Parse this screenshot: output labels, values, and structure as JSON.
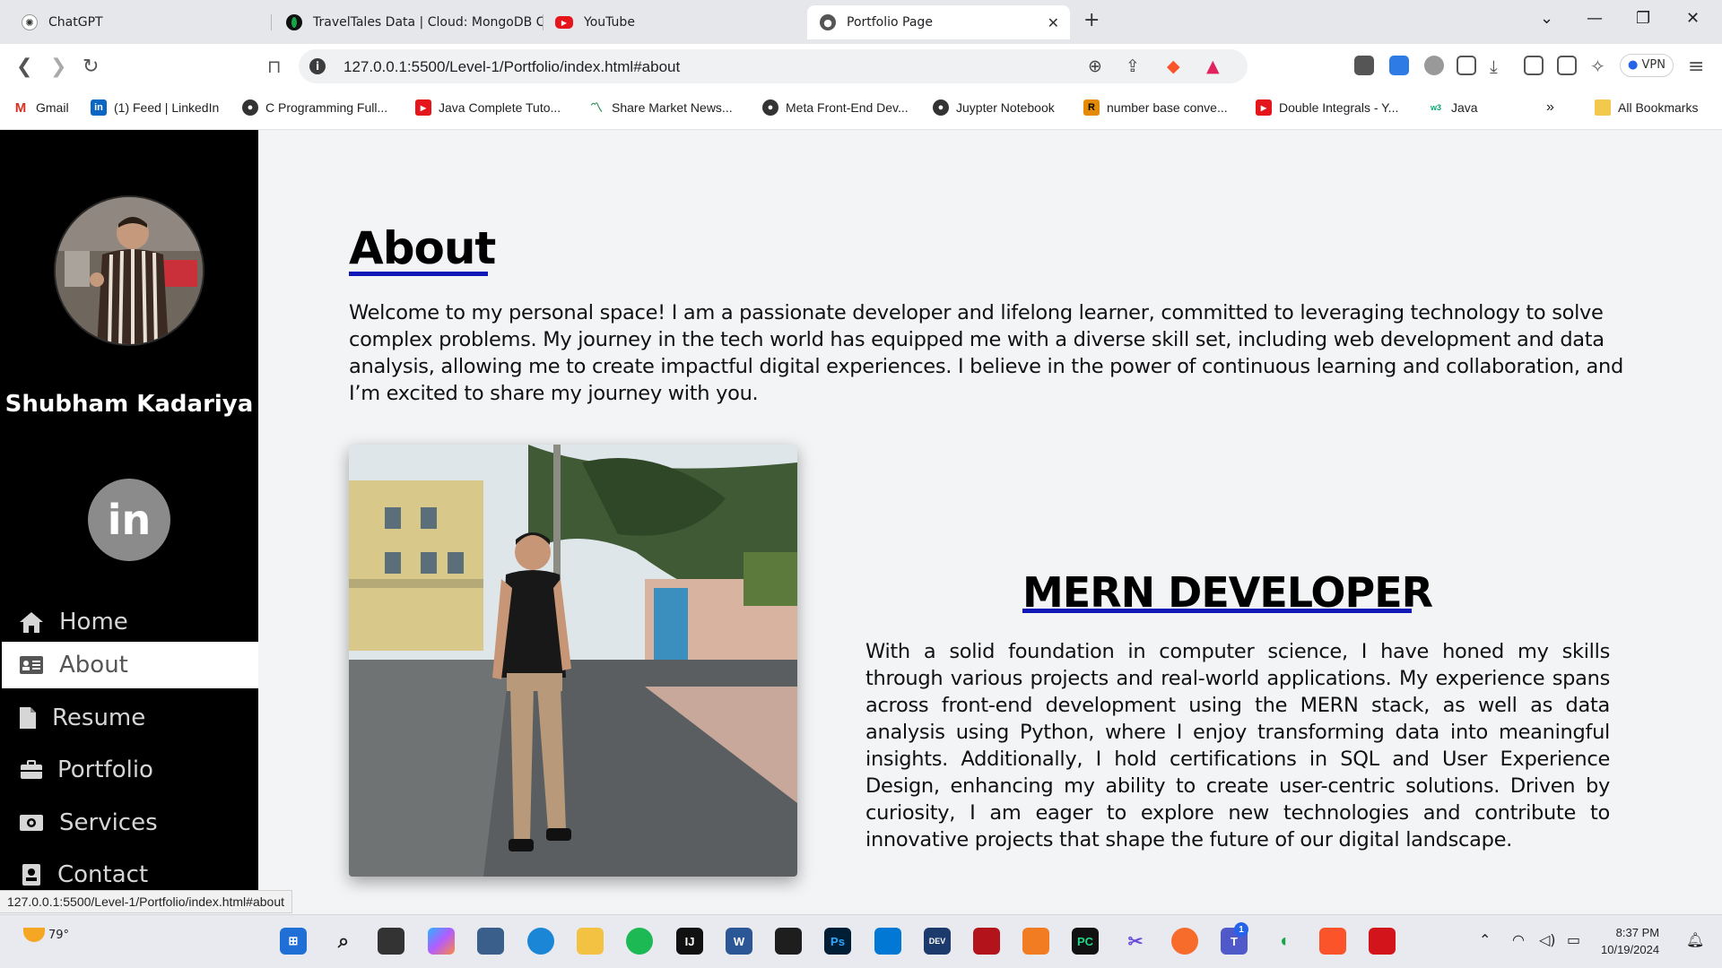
{
  "browser": {
    "tabs": [
      {
        "title": "ChatGPT",
        "active": false
      },
      {
        "title": "TravelTales Data | Cloud: MongoDB C",
        "active": false
      },
      {
        "title": "YouTube",
        "active": false
      },
      {
        "title": "Portfolio Page",
        "active": true
      }
    ],
    "url": "127.0.0.1:5500/Level-1/Portfolio/index.html#about",
    "vpn_label": "VPN",
    "bookmarks": [
      "Gmail",
      "(1) Feed | LinkedIn",
      "C Programming Full...",
      "Java Complete Tuto...",
      "Share Market News...",
      "Meta Front-End Dev...",
      "Juypter Notebook",
      "number base conve...",
      "Double Integrals - Y...",
      "Java"
    ],
    "all_bookmarks_label": "All Bookmarks",
    "status_url": "127.0.0.1:5500/Level-1/Portfolio/index.html#about"
  },
  "sidebar": {
    "name": "Shubham Kadariya",
    "linkedin_glyph": "in",
    "nav": [
      {
        "label": "Home",
        "icon": "home-icon",
        "active": false
      },
      {
        "label": "About",
        "icon": "id-card-icon",
        "active": true
      },
      {
        "label": "Resume",
        "icon": "file-icon",
        "active": false
      },
      {
        "label": "Portfolio",
        "icon": "briefcase-icon",
        "active": false
      },
      {
        "label": "Services",
        "icon": "money-icon",
        "active": false
      },
      {
        "label": "Contact",
        "icon": "address-book-icon",
        "active": false
      }
    ]
  },
  "about": {
    "title": "About",
    "intro": "Welcome to my personal space! I am a passionate developer and lifelong learner, committed to leveraging technology to solve complex problems. My journey in the tech world has equipped me with a diverse skill set, including web development and data analysis, allowing me to create impactful digital experiences. I believe in the power of continuous learning and collaboration, and I’m excited to share my journey with you.",
    "role_title": "MERN DEVELOPER",
    "role_text": "With a solid foundation in computer science, I have honed my skills through various projects and real-world applications. My experience spans across front-end development using the MERN stack, as well as data analysis using Python, where I enjoy transforming data into meaningful insights. Additionally, I hold certifications in SQL and User Experience Design, enhancing my ability to create user-centric solutions. Driven by curiosity, I am eager to explore new technologies and contribute to innovative projects that shape the future of our digital landscape."
  },
  "taskbar": {
    "weather": "79°",
    "time": "8:37 PM",
    "date": "10/19/2024",
    "teams_badge": "1"
  },
  "colors": {
    "accent_underline": "#1118b8",
    "sidebar_bg": "#000000",
    "page_bg": "#f3f4f6"
  }
}
